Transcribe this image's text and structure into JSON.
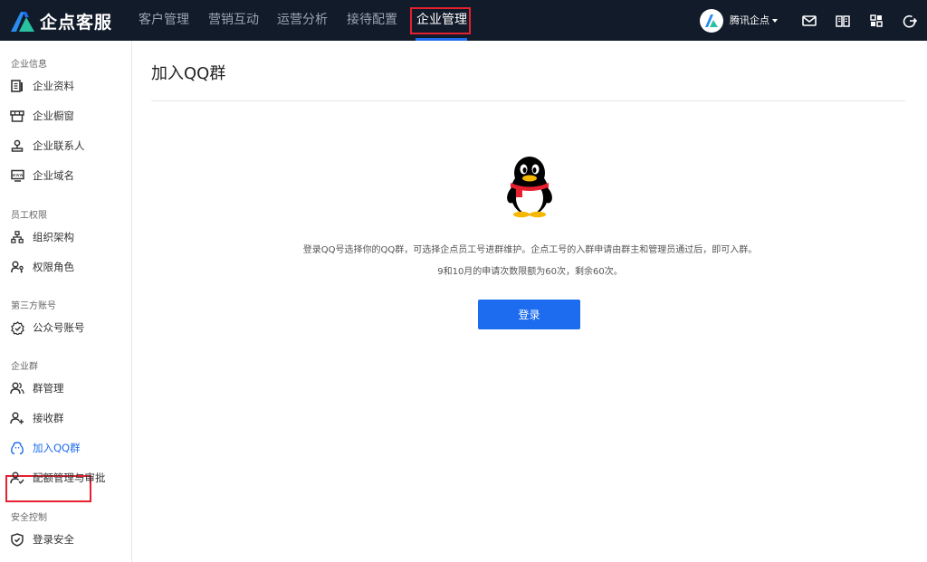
{
  "brand": {
    "name": "企点客服"
  },
  "nav": {
    "items": [
      {
        "label": "客户管理"
      },
      {
        "label": "营销互动"
      },
      {
        "label": "运营分析"
      },
      {
        "label": "接待配置"
      },
      {
        "label": "企业管理",
        "active": true
      }
    ]
  },
  "account": {
    "company": "腾讯企点"
  },
  "top_icons": [
    "mail-icon",
    "book-icon",
    "apps-icon",
    "logout-icon"
  ],
  "sidebar": {
    "groups": [
      {
        "title": "企业信息",
        "items": [
          {
            "label": "企业资料",
            "icon": "document-icon"
          },
          {
            "label": "企业橱窗",
            "icon": "storefront-icon"
          },
          {
            "label": "企业联系人",
            "icon": "contact-icon"
          },
          {
            "label": "企业域名",
            "icon": "domain-icon"
          }
        ]
      },
      {
        "title": "员工权限",
        "items": [
          {
            "label": "组织架构",
            "icon": "org-chart-icon"
          },
          {
            "label": "权限角色",
            "icon": "role-icon"
          }
        ]
      },
      {
        "title": "第三方账号",
        "items": [
          {
            "label": "公众号账号",
            "icon": "official-account-icon"
          }
        ]
      },
      {
        "title": "企业群",
        "items": [
          {
            "label": "群管理",
            "icon": "group-icon"
          },
          {
            "label": "接收群",
            "icon": "group-add-icon"
          },
          {
            "label": "加入QQ群",
            "icon": "qq-icon",
            "active": true
          },
          {
            "label": "配额管理与审批",
            "icon": "quota-icon"
          }
        ]
      },
      {
        "title": "安全控制",
        "items": [
          {
            "label": "登录安全",
            "icon": "shield-icon"
          }
        ]
      }
    ]
  },
  "main": {
    "title": "加入QQ群",
    "description": "登录QQ号选择你的QQ群，可选择企点员工号进群维护。企点工号的入群申请由群主和管理员通过后，即可入群。",
    "quota_note": "9和10月的申请次数限额为60次，剩余60次。",
    "login_button": "登录"
  },
  "colors": {
    "topbar_bg": "#111b2a",
    "accent": "#1d6cf0",
    "highlight_border": "#e5202f"
  }
}
